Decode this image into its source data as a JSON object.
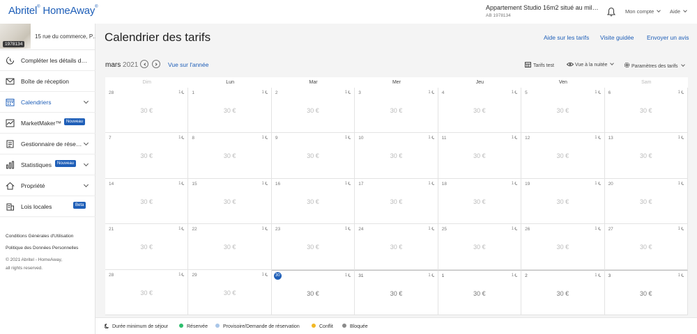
{
  "topbar": {
    "logo_left": "Abritel",
    "logo_right": "HomeAway",
    "property_title": "Appartement Studio 16m2 situé au mil…",
    "property_id": "AB 1978134",
    "account_label": "Mon compte",
    "help_label": "Aide"
  },
  "sidebar": {
    "property_badge": "1978134",
    "property_address": "15 rue du commerce, P…",
    "items": [
      {
        "label": "Compléter les détails d…",
        "icon": "progress-icon"
      },
      {
        "label": "Boîte de réception",
        "icon": "mail-icon"
      },
      {
        "label": "Calendriers",
        "icon": "calendar-icon",
        "active": true
      },
      {
        "label": "MarketMaker™",
        "icon": "chart-icon",
        "badge": "Nouveau"
      },
      {
        "label": "Gestionnaire de rése…",
        "icon": "ledger-icon"
      },
      {
        "label": "Statistiques",
        "icon": "bar-chart-icon",
        "badge": "Nouveau"
      },
      {
        "label": "Propriété",
        "icon": "house-icon"
      },
      {
        "label": "Lois locales",
        "icon": "building-icon",
        "badge": "Beta"
      }
    ],
    "footer": {
      "terms": "Conditions Générales d'Utilisation",
      "privacy": "Politique des Données Personnelles",
      "copyright": "© 2021 Abritel - HomeAway,",
      "rights": "all rights reserved."
    }
  },
  "main": {
    "title": "Calendrier des tarifs",
    "links": {
      "help": "Aide sur les tarifs",
      "tour": "Visite guidée",
      "feedback": "Envoyer un avis"
    },
    "month": "mars",
    "year": "2021",
    "year_view": "Vue sur l'année",
    "tools": {
      "test": "Tarifs test",
      "view": "Vue à la nuitée",
      "settings": "Paramètres des tarifs"
    }
  },
  "calendar": {
    "weekdays": [
      "Dim",
      "Lun",
      "Mar",
      "Mer",
      "Jeu",
      "Ven",
      "Sam"
    ],
    "min_stay": "1",
    "weeks": [
      [
        {
          "d": "28",
          "p": "30 €"
        },
        {
          "d": "1",
          "p": "30 €"
        },
        {
          "d": "2",
          "p": "30 €"
        },
        {
          "d": "3",
          "p": "30 €"
        },
        {
          "d": "4",
          "p": "30 €"
        },
        {
          "d": "5",
          "p": "30 €"
        },
        {
          "d": "6",
          "p": "30 €"
        }
      ],
      [
        {
          "d": "7",
          "p": "30 €"
        },
        {
          "d": "8",
          "p": "30 €"
        },
        {
          "d": "9",
          "p": "30 €"
        },
        {
          "d": "10",
          "p": "30 €"
        },
        {
          "d": "11",
          "p": "30 €"
        },
        {
          "d": "12",
          "p": "30 €"
        },
        {
          "d": "13",
          "p": "30 €"
        }
      ],
      [
        {
          "d": "14",
          "p": "30 €"
        },
        {
          "d": "15",
          "p": "30 €"
        },
        {
          "d": "16",
          "p": "30 €"
        },
        {
          "d": "17",
          "p": "30 €"
        },
        {
          "d": "18",
          "p": "30 €"
        },
        {
          "d": "19",
          "p": "30 €"
        },
        {
          "d": "20",
          "p": "30 €"
        }
      ],
      [
        {
          "d": "21",
          "p": "30 €"
        },
        {
          "d": "22",
          "p": "30 €"
        },
        {
          "d": "23",
          "p": "30 €"
        },
        {
          "d": "24",
          "p": "30 €"
        },
        {
          "d": "25",
          "p": "30 €"
        },
        {
          "d": "26",
          "p": "30 €"
        },
        {
          "d": "27",
          "p": "30 €"
        }
      ],
      [
        {
          "d": "28",
          "p": "30 €"
        },
        {
          "d": "29",
          "p": "30 €"
        },
        {
          "d": "30",
          "p": "30 €",
          "today": true,
          "cur": true
        },
        {
          "d": "31",
          "p": "30 €",
          "cur": true
        },
        {
          "d": "1",
          "p": "30 €",
          "cur": true
        },
        {
          "d": "2",
          "p": "30 €",
          "cur": true
        },
        {
          "d": "3",
          "p": "30 €",
          "cur": true
        }
      ]
    ]
  },
  "legend": [
    {
      "label": "Durée minimum de séjour",
      "icon": "moon-icon"
    },
    {
      "label": "Réservée",
      "color": "#2dbe6c"
    },
    {
      "label": "Provisoire/Demande de réservation",
      "color": "#a9c6e8"
    },
    {
      "label": "Conflit",
      "color": "#f2b824"
    },
    {
      "label": "Bloquée",
      "color": "#8a8a8a"
    }
  ]
}
